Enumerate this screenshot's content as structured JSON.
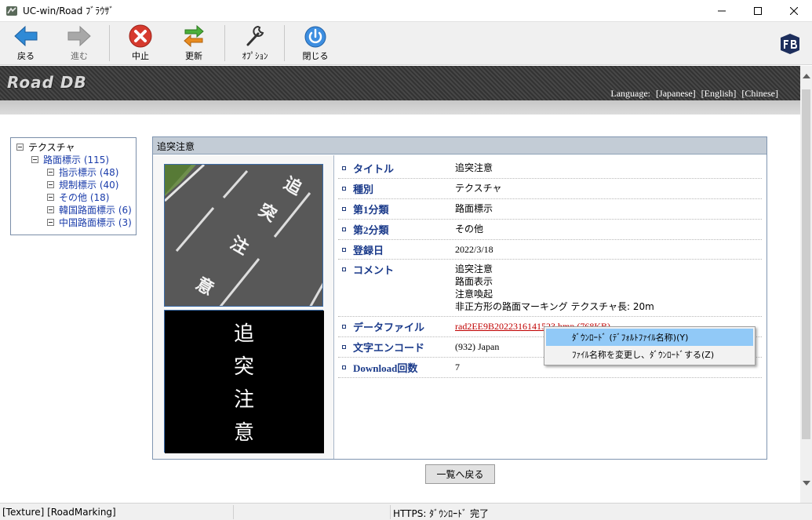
{
  "window": {
    "title": "UC-win/Road ﾌﾞﾗｳｻﾞ"
  },
  "toolbar": {
    "back": "戻る",
    "forward": "進む",
    "stop": "中止",
    "refresh": "更新",
    "options": "ｵﾌﾟｼｮﾝ",
    "close": "閉じる"
  },
  "banner": {
    "logo": "Road DB",
    "language_label": "Language:",
    "languages": [
      "[Japanese]",
      "[English]",
      "[Chinese]"
    ]
  },
  "tree": {
    "root": "テクスチャ",
    "child": "路面標示",
    "child_count": "(115)",
    "items": [
      {
        "label": "指示標示",
        "count": "(48)"
      },
      {
        "label": "規制標示",
        "count": "(40)"
      },
      {
        "label": "その他",
        "count": "(18)"
      },
      {
        "label": "韓国路面標示",
        "count": "(6)"
      },
      {
        "label": "中国路面標示",
        "count": "(3)"
      }
    ]
  },
  "panel": {
    "header": "追突注意",
    "marking_chars": [
      "追",
      "突",
      "注",
      "意"
    ],
    "fields": [
      {
        "key": "タイトル",
        "value": "追突注意"
      },
      {
        "key": "種別",
        "value": "テクスチャ"
      },
      {
        "key": "第1分類",
        "value": "路面標示"
      },
      {
        "key": "第2分類",
        "value": "その他"
      },
      {
        "key": "登録日",
        "value": "2022/3/18"
      },
      {
        "key": "コメント",
        "lines": [
          "追突注意",
          "路面表示",
          "注意喚起",
          "非正方形の路面マーキング テクスチャ長: 20m"
        ]
      },
      {
        "key": "データファイル",
        "value": "rad2EE9B2022316141523.bmp (768KB)"
      },
      {
        "key": "文字エンコード",
        "value": "(932) Japan"
      },
      {
        "key": "Download回数",
        "value": "7"
      }
    ]
  },
  "back_button": "一覧へ戻る",
  "context_menu": {
    "items": [
      "ﾀﾞｳﾝﾛｰﾄﾞ (ﾃﾞﾌｫﾙﾄﾌｧｲﾙ名称)(Y)",
      "ﾌｧｲﾙ名称を変更し、ﾀﾞｳﾝﾛｰﾄﾞする(Z)"
    ]
  },
  "status": {
    "left": "[Texture] [RoadMarking]",
    "middle": "HTTPS: ﾀﾞｳﾝﾛｰﾄﾞ 完了",
    "right": ""
  }
}
